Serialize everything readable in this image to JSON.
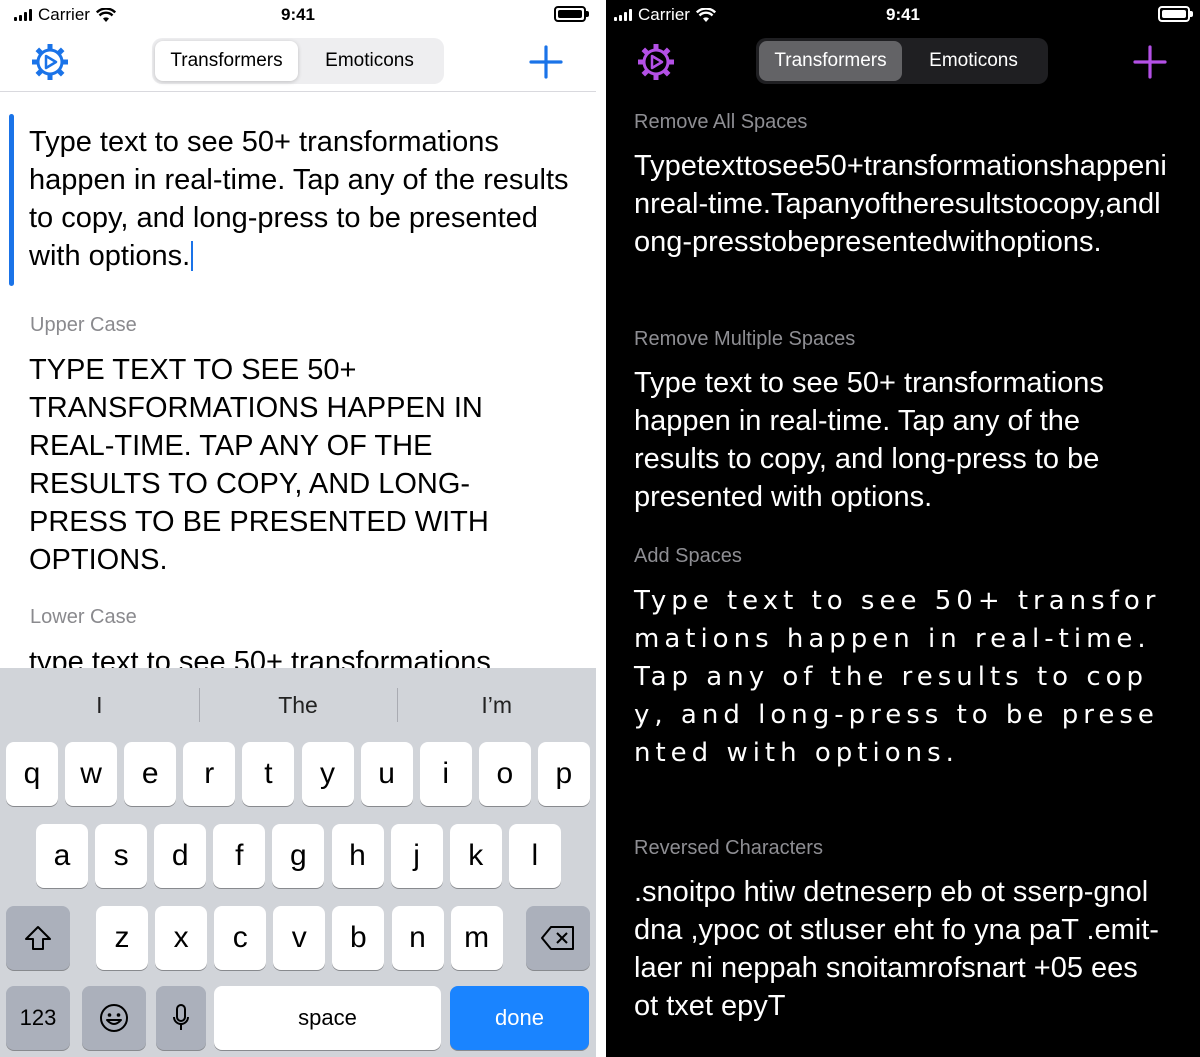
{
  "status_bar": {
    "carrier": "Carrier",
    "time": "9:41"
  },
  "nav": {
    "segments": [
      "Transformers",
      "Emoticons"
    ],
    "selected_segment": "Transformers",
    "light_accent": "#1a73e8",
    "dark_accent": "#b450e6"
  },
  "input": {
    "text": "Type text to see 50+ transformations happen in real-time. Tap any of the results to copy, and long-press to be presented with options."
  },
  "light_results": [
    {
      "label": "Upper Case",
      "text": "TYPE TEXT TO SEE 50+ TRANSFORMATIONS HAPPEN IN REAL-TIME. TAP ANY OF THE RESULTS TO COPY, AND LONG-PRESS TO BE PRESENTED WITH OPTIONS."
    },
    {
      "label": "Lower Case",
      "text": "type text to see 50+ transformations"
    }
  ],
  "dark_results": [
    {
      "label": "Remove All Spaces",
      "text": "Typetexttosee50+transformationshappeninreal-time.Tapanyoftheresultstocopy,andlong-presstobepresentedwithoptions."
    },
    {
      "label": "Remove Multiple Spaces",
      "text": "Type text to see 50+ transformations happen in real-time. Tap any of the results to copy, and long-press to be presented with options."
    },
    {
      "label": "Add Spaces",
      "text": "Type text to see 50+ transformations happen in real-time. Tap any of the results to copy, and long-press to be presented with options."
    },
    {
      "label": "Reversed Characters",
      "text": ".snoitpo htiw detneserp eb ot sserp-gnol dna ,ypoc ot stluser eht fo yna paT .emit-laer ni neppah snoitamrofsnart +05 ees ot txet epyT"
    }
  ],
  "keyboard": {
    "suggestions": [
      "I",
      "The",
      "I’m"
    ],
    "row1": [
      "q",
      "w",
      "e",
      "r",
      "t",
      "y",
      "u",
      "i",
      "o",
      "p"
    ],
    "row2": [
      "a",
      "s",
      "d",
      "f",
      "g",
      "h",
      "j",
      "k",
      "l"
    ],
    "row3": [
      "z",
      "x",
      "c",
      "v",
      "b",
      "n",
      "m"
    ],
    "numbers_label": "123",
    "space_label": "space",
    "done_label": "done"
  }
}
